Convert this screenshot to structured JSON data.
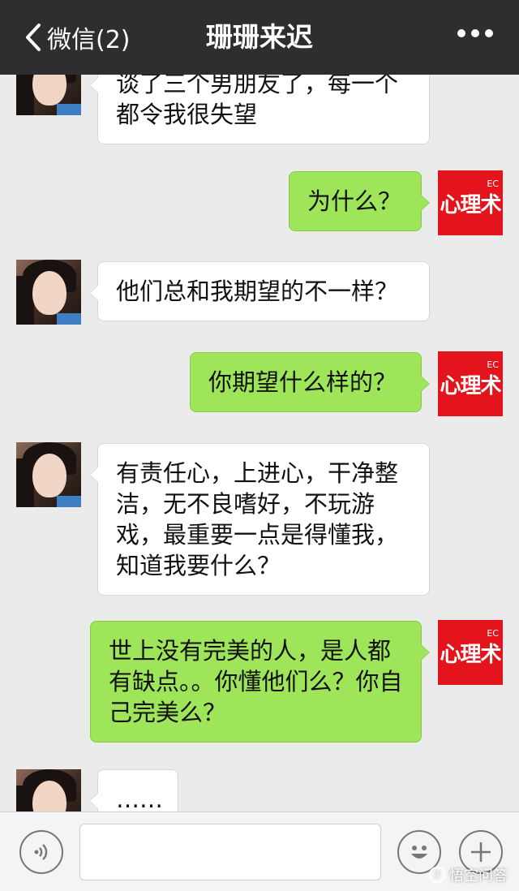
{
  "header": {
    "back_label": "微信(2)",
    "title": "珊珊来迟",
    "more_icon": "more-dots-icon"
  },
  "messages": [
    {
      "side": "left",
      "text": "谈了三个男朋友了，每一个都令我很失望"
    },
    {
      "side": "right",
      "text": "为什么？"
    },
    {
      "side": "left",
      "text": "他们总和我期望的不一样？"
    },
    {
      "side": "right",
      "text": "你期望什么样的？"
    },
    {
      "side": "left",
      "text": "有责任心，上进心，干净整洁，无不良嗜好，不玩游戏，最重要一点是得懂我，知道我要什么？"
    },
    {
      "side": "right",
      "text": "世上没有完美的人，是人都有缺点。。你懂他们么？你自己完美么？"
    },
    {
      "side": "left",
      "text": "……"
    }
  ],
  "self_avatar": {
    "text": "心理术",
    "badge": "EC"
  },
  "input_bar": {
    "voice_icon": "voice-icon",
    "emoji_icon": "emoji-icon",
    "plus_icon": "plus-icon",
    "input_value": ""
  },
  "watermark": {
    "text": "悟空问答"
  },
  "colors": {
    "header_bg": "#2e2e30",
    "chat_bg": "#ebebeb",
    "self_bubble": "#9fe55a",
    "other_bubble": "#ffffff",
    "logo_red": "#e3141c"
  }
}
